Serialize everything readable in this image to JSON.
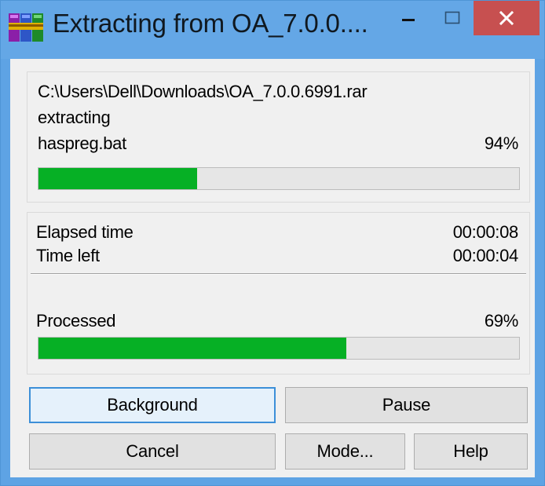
{
  "window": {
    "title": "Extracting from OA_7.0.0....",
    "icons": {
      "app": "winrar-books-icon",
      "minimize": "minimize-icon",
      "maximize": "maximize-icon",
      "close": "close-icon"
    }
  },
  "archive": {
    "path": "C:\\Users\\Dell\\Downloads\\OA_7.0.0.6991.rar",
    "operation": "extracting",
    "current_file": "haspreg.bat",
    "file_percent_label": "94%",
    "file_progress": 0.33
  },
  "stats": {
    "elapsed_label": "Elapsed time",
    "elapsed_value": "00:00:08",
    "left_label": "Time left",
    "left_value": "00:00:04",
    "processed_label": "Processed",
    "processed_percent_label": "69%",
    "processed_progress": 0.64
  },
  "buttons": {
    "background": "Background",
    "pause": "Pause",
    "cancel": "Cancel",
    "mode": "Mode...",
    "help": "Help"
  },
  "colors": {
    "progress": "#06b025",
    "close": "#c75050",
    "title_bar": "#64a7e6"
  }
}
